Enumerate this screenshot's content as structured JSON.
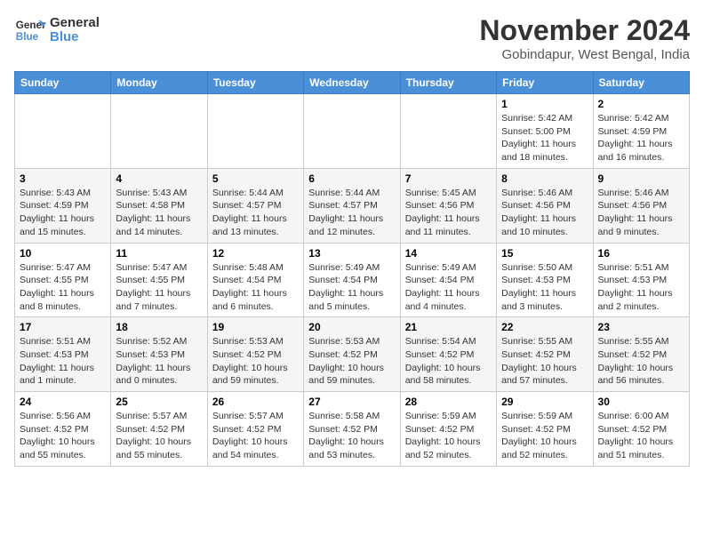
{
  "logo": {
    "line1": "General",
    "line2": "Blue"
  },
  "title": "November 2024",
  "location": "Gobindapur, West Bengal, India",
  "weekdays": [
    "Sunday",
    "Monday",
    "Tuesday",
    "Wednesday",
    "Thursday",
    "Friday",
    "Saturday"
  ],
  "weeks": [
    [
      {
        "day": "",
        "info": ""
      },
      {
        "day": "",
        "info": ""
      },
      {
        "day": "",
        "info": ""
      },
      {
        "day": "",
        "info": ""
      },
      {
        "day": "",
        "info": ""
      },
      {
        "day": "1",
        "info": "Sunrise: 5:42 AM\nSunset: 5:00 PM\nDaylight: 11 hours and 18 minutes."
      },
      {
        "day": "2",
        "info": "Sunrise: 5:42 AM\nSunset: 4:59 PM\nDaylight: 11 hours and 16 minutes."
      }
    ],
    [
      {
        "day": "3",
        "info": "Sunrise: 5:43 AM\nSunset: 4:59 PM\nDaylight: 11 hours and 15 minutes."
      },
      {
        "day": "4",
        "info": "Sunrise: 5:43 AM\nSunset: 4:58 PM\nDaylight: 11 hours and 14 minutes."
      },
      {
        "day": "5",
        "info": "Sunrise: 5:44 AM\nSunset: 4:57 PM\nDaylight: 11 hours and 13 minutes."
      },
      {
        "day": "6",
        "info": "Sunrise: 5:44 AM\nSunset: 4:57 PM\nDaylight: 11 hours and 12 minutes."
      },
      {
        "day": "7",
        "info": "Sunrise: 5:45 AM\nSunset: 4:56 PM\nDaylight: 11 hours and 11 minutes."
      },
      {
        "day": "8",
        "info": "Sunrise: 5:46 AM\nSunset: 4:56 PM\nDaylight: 11 hours and 10 minutes."
      },
      {
        "day": "9",
        "info": "Sunrise: 5:46 AM\nSunset: 4:56 PM\nDaylight: 11 hours and 9 minutes."
      }
    ],
    [
      {
        "day": "10",
        "info": "Sunrise: 5:47 AM\nSunset: 4:55 PM\nDaylight: 11 hours and 8 minutes."
      },
      {
        "day": "11",
        "info": "Sunrise: 5:47 AM\nSunset: 4:55 PM\nDaylight: 11 hours and 7 minutes."
      },
      {
        "day": "12",
        "info": "Sunrise: 5:48 AM\nSunset: 4:54 PM\nDaylight: 11 hours and 6 minutes."
      },
      {
        "day": "13",
        "info": "Sunrise: 5:49 AM\nSunset: 4:54 PM\nDaylight: 11 hours and 5 minutes."
      },
      {
        "day": "14",
        "info": "Sunrise: 5:49 AM\nSunset: 4:54 PM\nDaylight: 11 hours and 4 minutes."
      },
      {
        "day": "15",
        "info": "Sunrise: 5:50 AM\nSunset: 4:53 PM\nDaylight: 11 hours and 3 minutes."
      },
      {
        "day": "16",
        "info": "Sunrise: 5:51 AM\nSunset: 4:53 PM\nDaylight: 11 hours and 2 minutes."
      }
    ],
    [
      {
        "day": "17",
        "info": "Sunrise: 5:51 AM\nSunset: 4:53 PM\nDaylight: 11 hours and 1 minute."
      },
      {
        "day": "18",
        "info": "Sunrise: 5:52 AM\nSunset: 4:53 PM\nDaylight: 11 hours and 0 minutes."
      },
      {
        "day": "19",
        "info": "Sunrise: 5:53 AM\nSunset: 4:52 PM\nDaylight: 10 hours and 59 minutes."
      },
      {
        "day": "20",
        "info": "Sunrise: 5:53 AM\nSunset: 4:52 PM\nDaylight: 10 hours and 59 minutes."
      },
      {
        "day": "21",
        "info": "Sunrise: 5:54 AM\nSunset: 4:52 PM\nDaylight: 10 hours and 58 minutes."
      },
      {
        "day": "22",
        "info": "Sunrise: 5:55 AM\nSunset: 4:52 PM\nDaylight: 10 hours and 57 minutes."
      },
      {
        "day": "23",
        "info": "Sunrise: 5:55 AM\nSunset: 4:52 PM\nDaylight: 10 hours and 56 minutes."
      }
    ],
    [
      {
        "day": "24",
        "info": "Sunrise: 5:56 AM\nSunset: 4:52 PM\nDaylight: 10 hours and 55 minutes."
      },
      {
        "day": "25",
        "info": "Sunrise: 5:57 AM\nSunset: 4:52 PM\nDaylight: 10 hours and 55 minutes."
      },
      {
        "day": "26",
        "info": "Sunrise: 5:57 AM\nSunset: 4:52 PM\nDaylight: 10 hours and 54 minutes."
      },
      {
        "day": "27",
        "info": "Sunrise: 5:58 AM\nSunset: 4:52 PM\nDaylight: 10 hours and 53 minutes."
      },
      {
        "day": "28",
        "info": "Sunrise: 5:59 AM\nSunset: 4:52 PM\nDaylight: 10 hours and 52 minutes."
      },
      {
        "day": "29",
        "info": "Sunrise: 5:59 AM\nSunset: 4:52 PM\nDaylight: 10 hours and 52 minutes."
      },
      {
        "day": "30",
        "info": "Sunrise: 6:00 AM\nSunset: 4:52 PM\nDaylight: 10 hours and 51 minutes."
      }
    ]
  ]
}
